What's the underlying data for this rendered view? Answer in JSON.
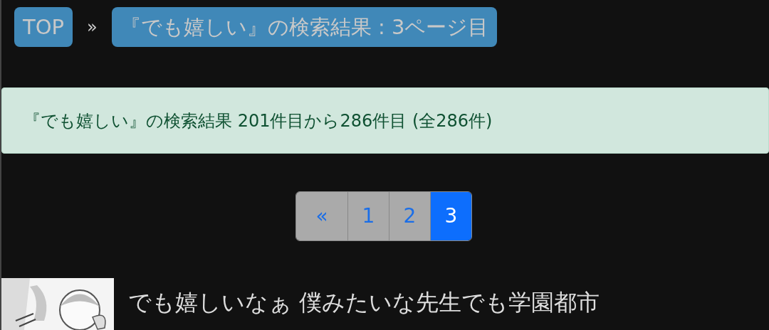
{
  "breadcrumb": [
    {
      "label": "TOP"
    },
    {
      "label": "『でも嬉しい』の検索結果 : 3ページ目"
    }
  ],
  "breadcrumb_separator": "»",
  "result_summary": "『でも嬉しい』の検索結果 201件目から286件目 (全286件)",
  "pagination": [
    {
      "label": "«",
      "selected": false
    },
    {
      "label": "1",
      "selected": false
    },
    {
      "label": "2",
      "selected": false
    },
    {
      "label": "3",
      "selected": true
    }
  ],
  "results": [
    {
      "text": "でも嬉しいなぁ 僕みたいな先生でも学園都市"
    }
  ]
}
